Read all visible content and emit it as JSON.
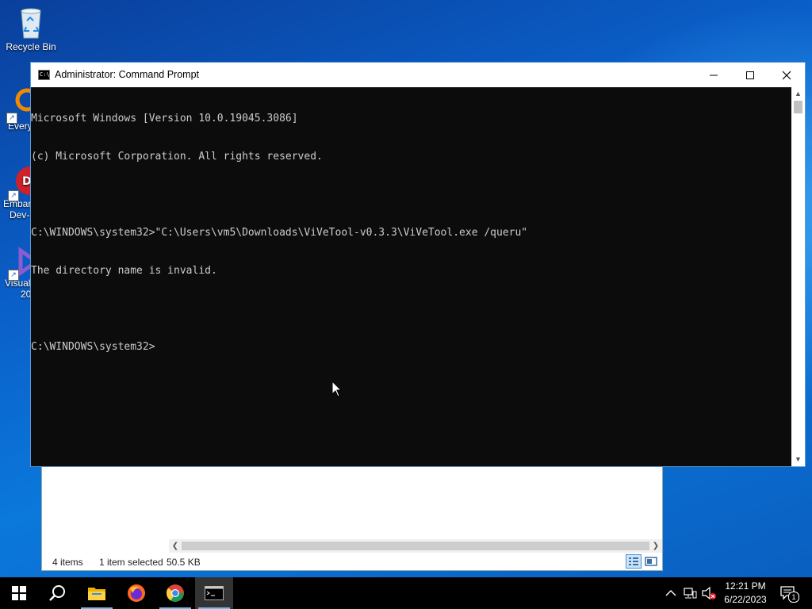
{
  "desktop": {
    "icons": [
      {
        "name": "recycle-bin",
        "label": "Recycle Bin",
        "sublabel": ""
      },
      {
        "name": "everything",
        "label": "Every",
        "sublabel": ""
      },
      {
        "name": "embarcadero",
        "label": "Embar",
        "sublabel": "Dev-"
      },
      {
        "name": "visual-studio",
        "label": "Visual",
        "sublabel": "20"
      }
    ]
  },
  "explorer": {
    "status_items": "4 items",
    "status_selected": "1 item selected",
    "status_size": "50.5 KB"
  },
  "cmd": {
    "title": "Administrator:  Command Prompt",
    "lines": [
      "Microsoft Windows [Version 10.0.19045.3086]",
      "(c) Microsoft Corporation. All rights reserved.",
      "",
      "C:\\WINDOWS\\system32>\"C:\\Users\\vm5\\Downloads\\ViVeTool-v0.3.3\\ViVeTool.exe /queru\"",
      "The directory name is invalid.",
      "",
      "C:\\WINDOWS\\system32>"
    ]
  },
  "taskbar": {
    "items": [
      "start",
      "search",
      "file-explorer",
      "firefox",
      "chrome",
      "command-prompt"
    ],
    "active_item": "command-prompt",
    "time": "12:21 PM",
    "date": "6/22/2023",
    "notification_count": "1"
  },
  "colors": {
    "console_bg": "#0c0c0c",
    "console_fg": "#cccccc",
    "accent": "#76b9ed"
  }
}
